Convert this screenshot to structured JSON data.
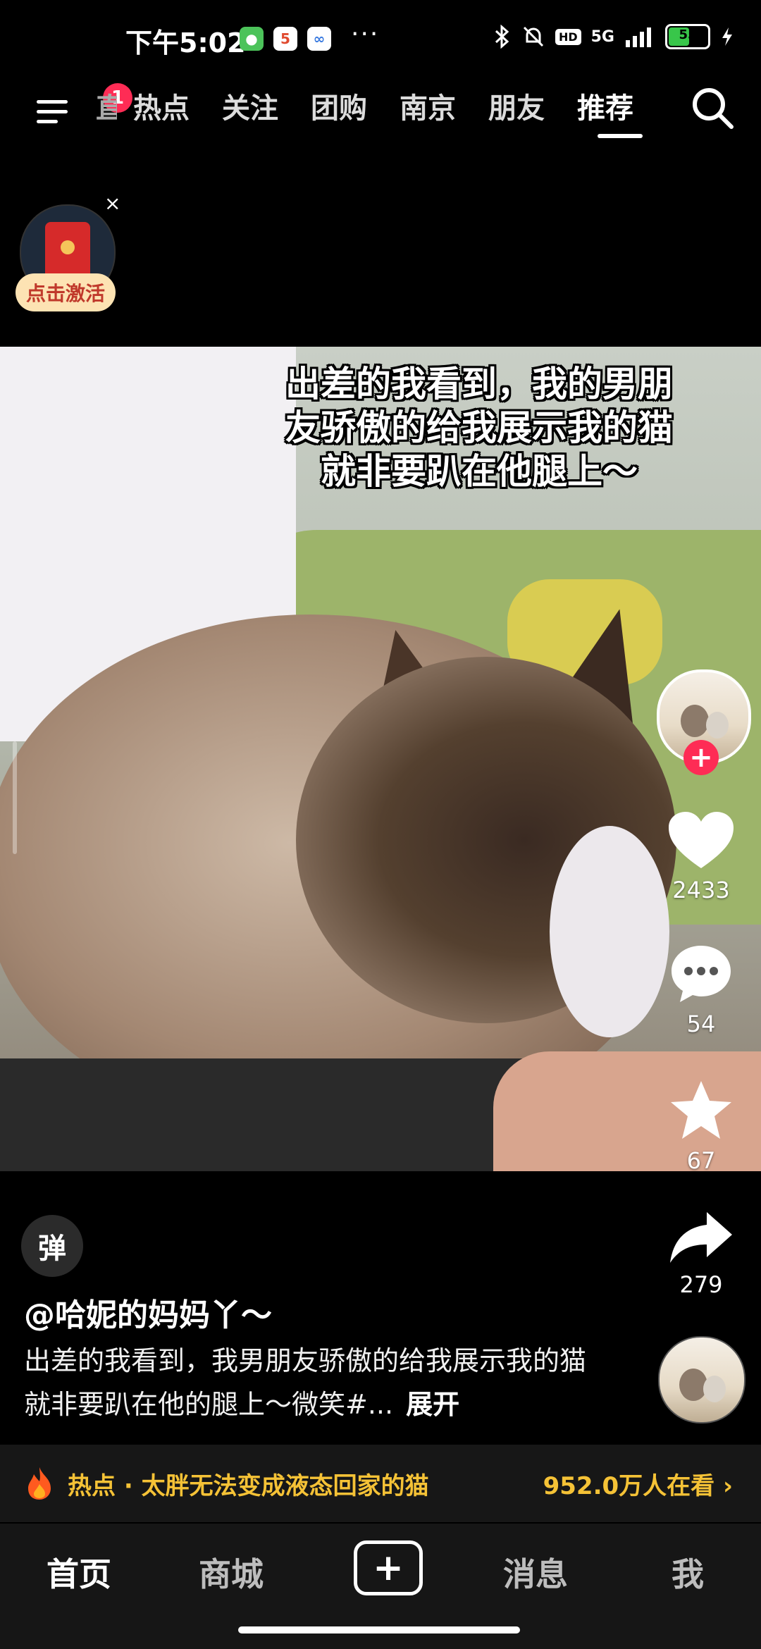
{
  "status_bar": {
    "time": "下午5:02",
    "more": "···",
    "hd": "HD",
    "network": "5G",
    "battery": "55",
    "battery_level": 0.55
  },
  "top_nav": {
    "badge_count": "1",
    "tab_partial": "直",
    "tabs": [
      "热点",
      "关注",
      "团购",
      "南京",
      "朋友",
      "推荐"
    ],
    "active_tab": "推荐"
  },
  "red_packet": {
    "label": "点击激活",
    "close": "×"
  },
  "video": {
    "caption": "出差的我看到，我的男朋友骄傲的给我展示我的猫就非要趴在他腿上～"
  },
  "actions": {
    "likes": "2433",
    "comments": "54",
    "favorites": "67",
    "shares": "279",
    "follow_plus": "+"
  },
  "post": {
    "bullet_btn": "弹",
    "author": "@哈妮的妈妈丫～",
    "description": "出差的我看到，我男朋友骄傲的给我展示我的猫就非要趴在他的腿上～微笑#...",
    "expand": "展开"
  },
  "hot_bar": {
    "text": "热点 · 太胖无法变成液态回家的猫",
    "watching": "952.0万人在看 ›"
  },
  "bottom_nav": {
    "items": [
      "首页",
      "商城",
      "消息",
      "我"
    ],
    "add": "+"
  },
  "colors": {
    "accent_red": "#fe2c55",
    "hot_yellow": "#f5c236",
    "battery_green": "#38c64a"
  }
}
